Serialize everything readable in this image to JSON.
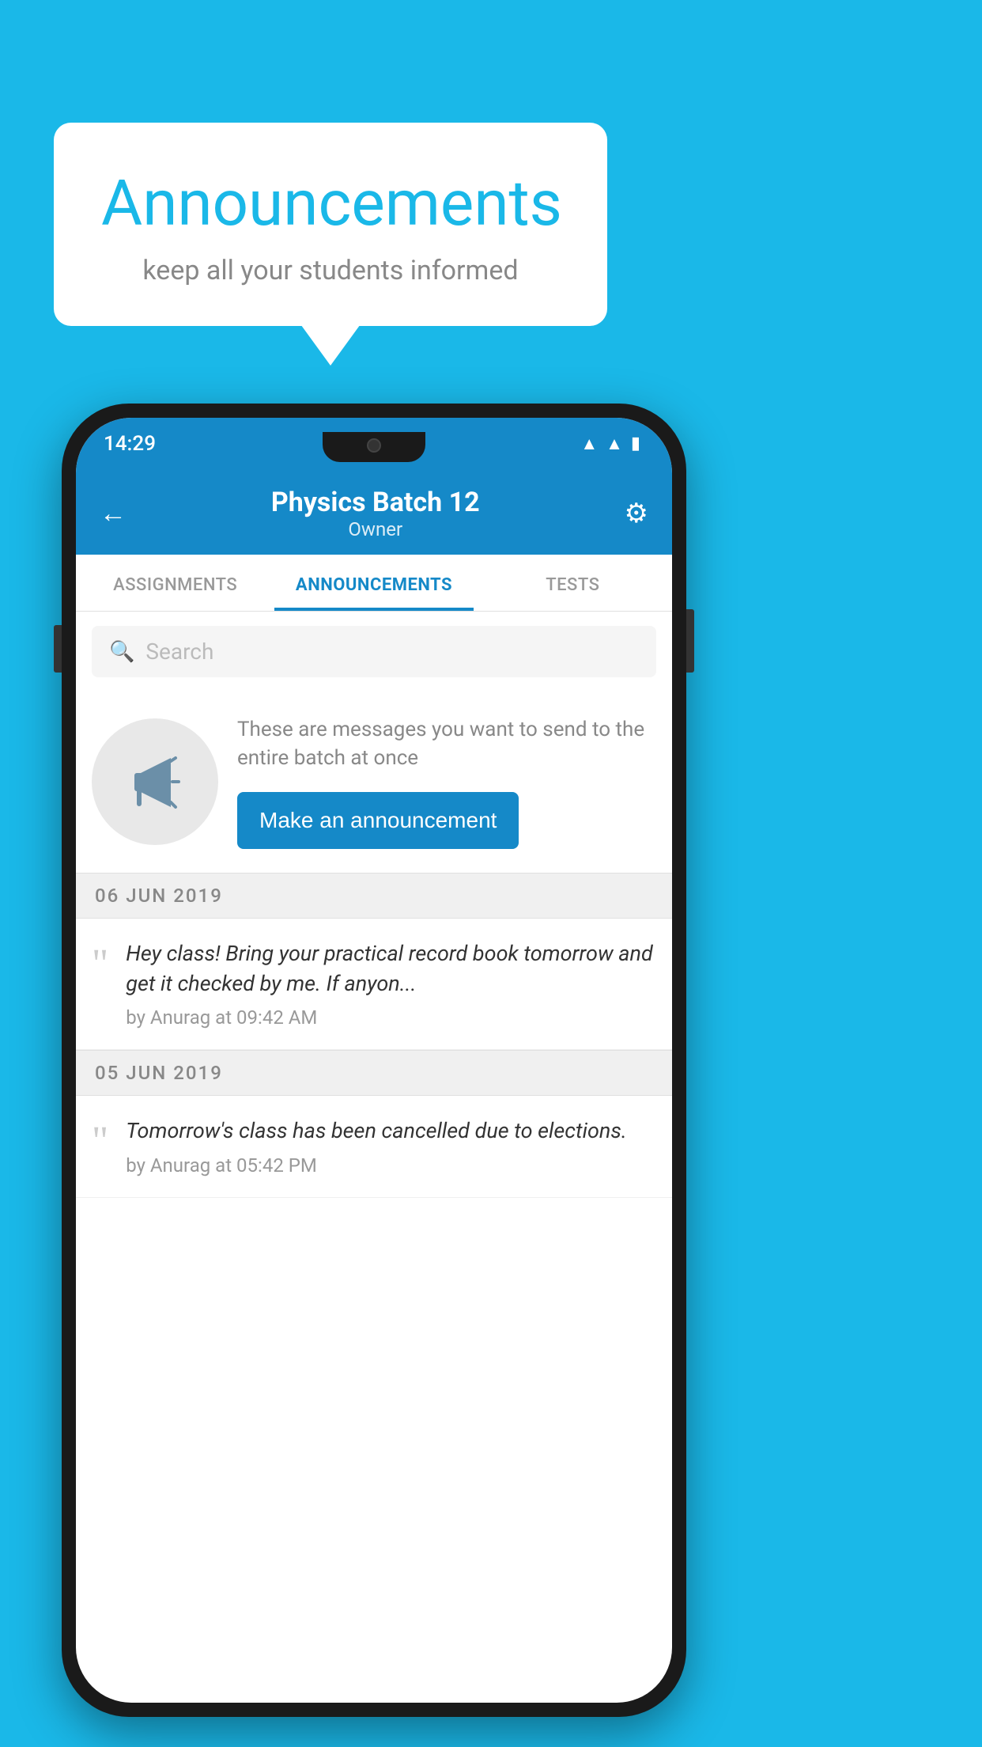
{
  "background_color": "#1ab8e8",
  "speech_bubble": {
    "title": "Announcements",
    "subtitle": "keep all your students informed"
  },
  "phone": {
    "status_bar": {
      "time": "14:29"
    },
    "header": {
      "title": "Physics Batch 12",
      "subtitle": "Owner",
      "back_label": "←",
      "settings_label": "⚙"
    },
    "tabs": [
      {
        "label": "ASSIGNMENTS",
        "active": false
      },
      {
        "label": "ANNOUNCEMENTS",
        "active": true
      },
      {
        "label": "TESTS",
        "active": false
      }
    ],
    "search": {
      "placeholder": "Search"
    },
    "promo": {
      "description": "These are messages you want to send to the entire batch at once",
      "button_label": "Make an announcement"
    },
    "announcements": [
      {
        "date": "06  JUN  2019",
        "text": "Hey class! Bring your practical record book tomorrow and get it checked by me. If anyon...",
        "meta": "by Anurag at 09:42 AM"
      },
      {
        "date": "05  JUN  2019",
        "text": "Tomorrow's class has been cancelled due to elections.",
        "meta": "by Anurag at 05:42 PM"
      }
    ]
  }
}
